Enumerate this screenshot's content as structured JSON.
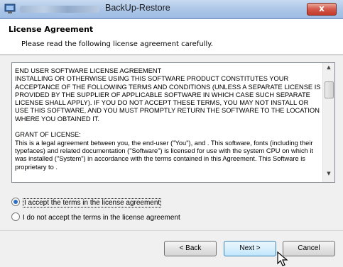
{
  "window": {
    "title": "BackUp-Restore",
    "close_glyph": "x"
  },
  "header": {
    "title": "License Agreement",
    "subtitle": "Please read the following license agreement carefully."
  },
  "license": {
    "text": "END USER SOFTWARE LICENSE AGREEMENT\nINSTALLING OR OTHERWISE USING THIS SOFTWARE PRODUCT CONSTITUTES YOUR ACCEPTANCE OF THE FOLLOWING TERMS AND CONDITIONS (UNLESS A SEPARATE LICENSE IS PROVIDED BY THE SUPPLIER OF APPLICABLE SOFTWARE IN WHICH CASE SUCH SEPARATE LICENSE SHALL APPLY). IF YOU DO NOT ACCEPT THESE TERMS, YOU MAY NOT INSTALL OR USE THIS SOFTWARE, AND YOU MUST PROMPTLY RETURN THE SOFTWARE TO THE LOCATION WHERE YOU OBTAINED IT.\n\nGRANT OF LICENSE:\nThis is a legal agreement between you, the end-user (\"You\"), and                               . This software, fonts (including their typefaces) and related documentation (\"Software\") is licensed for use with the system CPU on which it was installed (\"System\") in accordance with the terms contained in this Agreement. This Software is proprietary to         ."
  },
  "options": {
    "accept": "I accept the terms in the license agreement",
    "decline": "I do not accept the terms in the license agreement",
    "selected": "accept"
  },
  "buttons": {
    "back": "< Back",
    "next": "Next >",
    "cancel": "Cancel"
  },
  "colors": {
    "accent": "#2d6fc2",
    "close": "#c23a2a"
  }
}
